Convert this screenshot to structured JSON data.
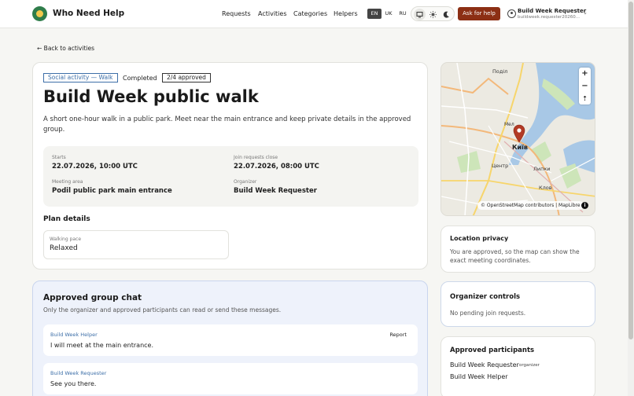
{
  "header": {
    "brand": "Who Need Help",
    "nav": [
      "Requests",
      "Activities",
      "Categories",
      "Helpers"
    ],
    "languages": [
      "EN",
      "UK",
      "RU"
    ],
    "active_language": "EN",
    "theme_icons": [
      "monitor-icon",
      "sun-icon",
      "moon-icon"
    ],
    "ask_label": "Ask for help",
    "user_name": "Build Week Requester",
    "user_email": "buildweek.requester20260...",
    "accent_color": "#8c2f14"
  },
  "back_label": "← Back to activities",
  "activity": {
    "category_tag": "Social activity — Walk",
    "status": "Completed",
    "approved_badge": "2/4 approved",
    "title": "Build Week public walk",
    "description": "A short one-hour walk in a public park. Meet near the main entrance and keep private details in the approved group.",
    "starts_label": "Starts",
    "starts_value": "22.07.2026, 10:00 UTC",
    "join_close_label": "Join requests close",
    "join_close_value": "22.07.2026, 08:00 UTC",
    "meeting_label": "Meeting area",
    "meeting_value": "Podil public park main entrance",
    "organizer_label": "Organizer",
    "organizer_value": "Build Week Requester",
    "plan_title": "Plan details",
    "pace_label": "Walking pace",
    "pace_value": "Relaxed"
  },
  "map": {
    "labels": [
      "Поділ",
      "Київ",
      "Центр",
      "Липки",
      "Клов",
      "Мел"
    ],
    "attribution": "© OpenStreetMap contributors | MapLibre",
    "zoom_in": "+",
    "zoom_out": "−",
    "reset": "⇡"
  },
  "privacy": {
    "title": "Location privacy",
    "text_line1": "You are approved, so the map can show the",
    "text_line2": "exact meeting coordinates."
  },
  "controls": {
    "title": "Organizer controls",
    "text": "No pending join requests."
  },
  "participants": {
    "title": "Approved participants",
    "items": [
      {
        "name": "Build Week Requester",
        "role": "organizer"
      },
      {
        "name": "Build Week Helper",
        "role": ""
      }
    ]
  },
  "chat": {
    "title": "Approved group chat",
    "subtitle": "Only the organizer and approved participants can read or send these messages.",
    "report_label": "Report",
    "messages": [
      {
        "author": "Build Week Helper",
        "text": "I will meet at the main entrance."
      },
      {
        "author": "Build Week Requester",
        "text": "See you there."
      }
    ]
  }
}
